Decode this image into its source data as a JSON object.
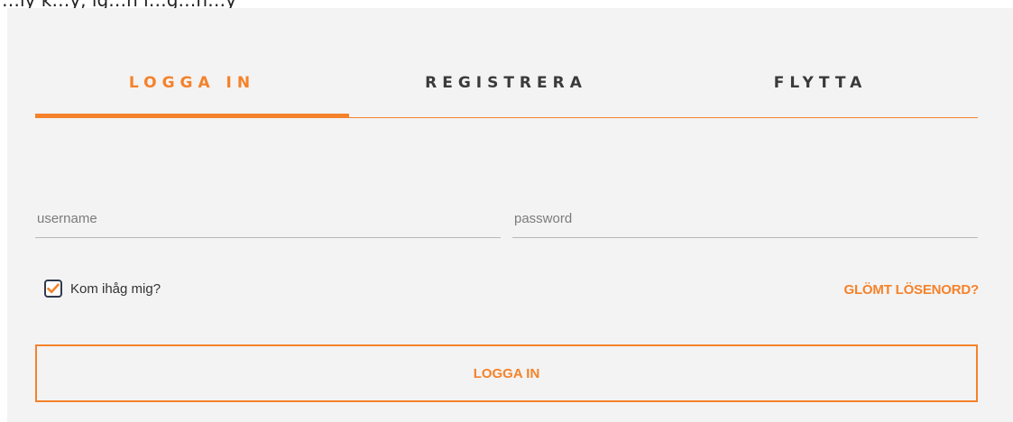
{
  "page": {
    "top_fragment": "…ly k…y, lg…n l…g…n…y"
  },
  "tabs": [
    {
      "label": "LOGGA IN",
      "active": true
    },
    {
      "label": "REGISTRERA",
      "active": false
    },
    {
      "label": "FLYTTA",
      "active": false
    }
  ],
  "form": {
    "username": {
      "placeholder": "username",
      "value": ""
    },
    "password": {
      "placeholder": "password",
      "value": ""
    },
    "remember": {
      "label": "Kom ihåg mig?",
      "checked": true
    },
    "forgot_label": "GLÖMT LÖSENORD?",
    "submit_label": "LOGGA IN"
  },
  "colors": {
    "accent": "#f5822a",
    "panel_bg": "#f3f3f3",
    "tab_inactive": "#3a3a3a",
    "checkbox_border": "#2e3a4e"
  },
  "icons": {
    "remember_check": "checkmark-icon"
  }
}
